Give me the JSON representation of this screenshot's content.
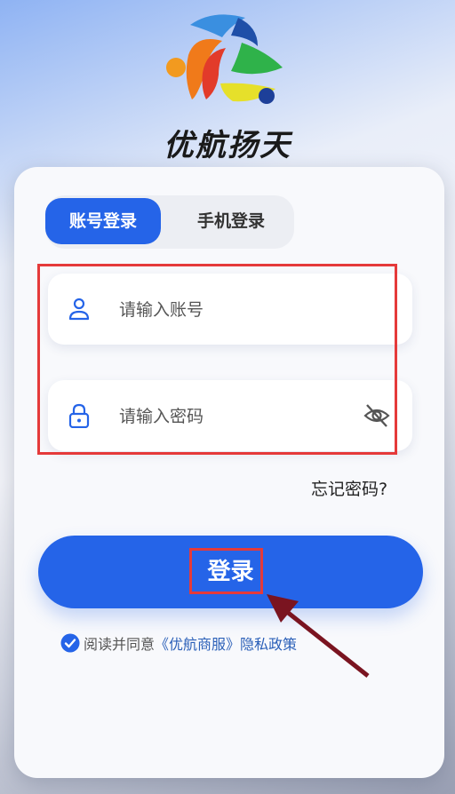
{
  "brand": {
    "name": "优航扬天"
  },
  "tabs": [
    {
      "label": "账号登录",
      "active": true
    },
    {
      "label": "手机登录",
      "active": false
    }
  ],
  "account_field": {
    "placeholder": "请输入账号",
    "value": ""
  },
  "password_field": {
    "placeholder": "请输入密码",
    "value": ""
  },
  "forgot_password": {
    "label": "忘记密码?"
  },
  "login_button": {
    "label": "登录"
  },
  "agreement": {
    "checked": true,
    "prefix": "阅读并同意",
    "terms_link": "《优航商服》",
    "privacy_link": "隐私政策"
  },
  "colors": {
    "primary": "#2564e8",
    "annotation_red": "#e53a3a",
    "arrow": "#7a1420"
  }
}
